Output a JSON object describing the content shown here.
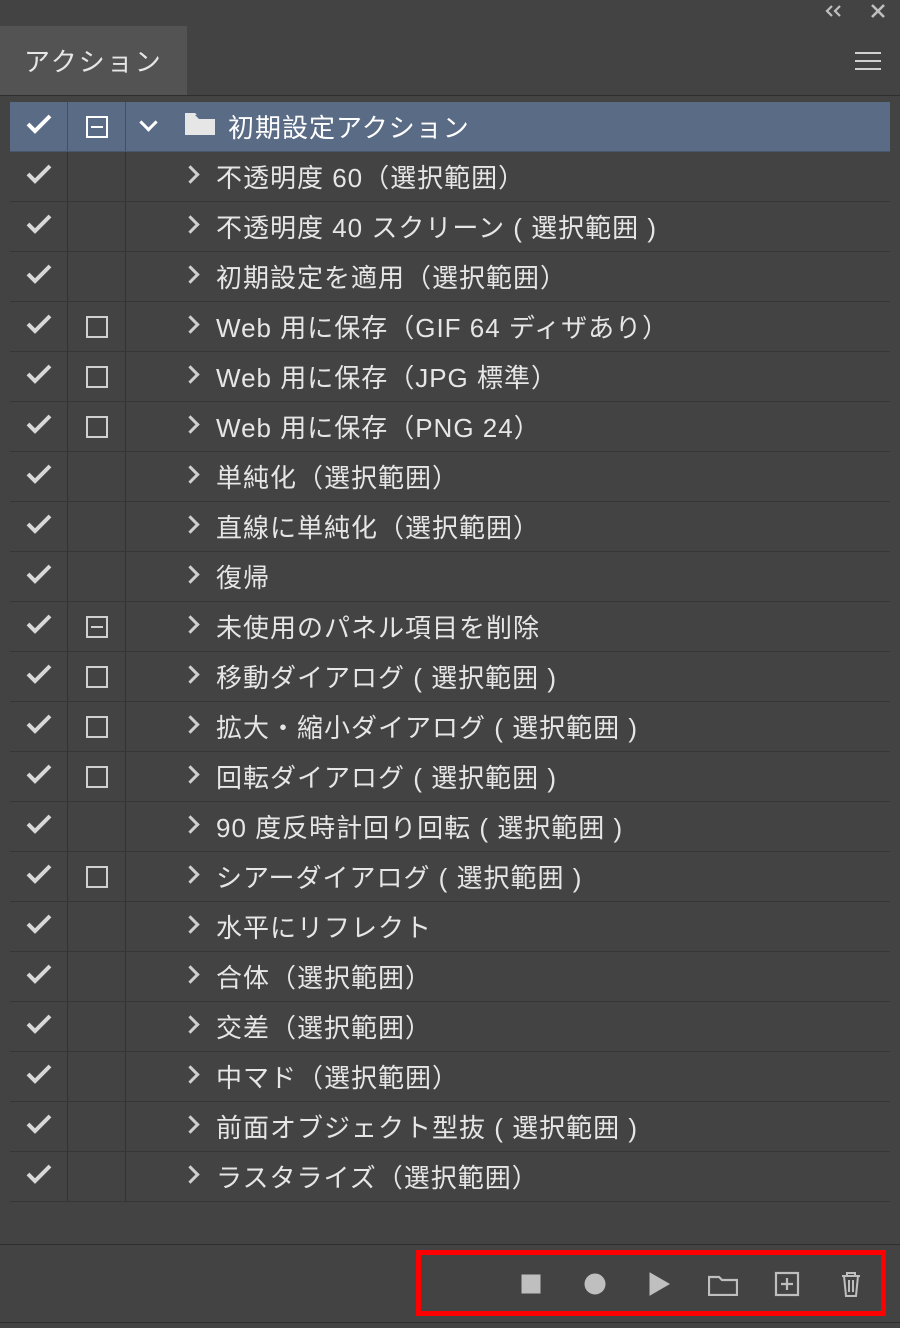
{
  "panel": {
    "tab_title": "アクション"
  },
  "set": {
    "name": "初期設定アクション"
  },
  "actions": [
    {
      "label": "不透明度 60（選択範囲）",
      "dialog": "none"
    },
    {
      "label": "不透明度 40 スクリーン ( 選択範囲 )",
      "dialog": "none"
    },
    {
      "label": "初期設定を適用（選択範囲）",
      "dialog": "none"
    },
    {
      "label": "Web 用に保存（GIF 64 ディザあり）",
      "dialog": "box"
    },
    {
      "label": "Web 用に保存（JPG 標準）",
      "dialog": "box"
    },
    {
      "label": "Web 用に保存（PNG 24）",
      "dialog": "box"
    },
    {
      "label": "単純化（選択範囲）",
      "dialog": "none"
    },
    {
      "label": "直線に単純化（選択範囲）",
      "dialog": "none"
    },
    {
      "label": "復帰",
      "dialog": "none"
    },
    {
      "label": "未使用のパネル項目を削除",
      "dialog": "minus"
    },
    {
      "label": "移動ダイアログ ( 選択範囲 )",
      "dialog": "box"
    },
    {
      "label": "拡大・縮小ダイアログ ( 選択範囲 )",
      "dialog": "box"
    },
    {
      "label": "回転ダイアログ ( 選択範囲 )",
      "dialog": "box"
    },
    {
      "label": "90 度反時計回り回転 ( 選択範囲 )",
      "dialog": "none"
    },
    {
      "label": "シアーダイアログ ( 選択範囲 )",
      "dialog": "box"
    },
    {
      "label": "水平にリフレクト",
      "dialog": "none"
    },
    {
      "label": "合体（選択範囲）",
      "dialog": "none"
    },
    {
      "label": "交差（選択範囲）",
      "dialog": "none"
    },
    {
      "label": "中マド（選択範囲）",
      "dialog": "none"
    },
    {
      "label": "前面オブジェクト型抜 ( 選択範囲 )",
      "dialog": "none"
    },
    {
      "label": "ラスタライズ（選択範囲）",
      "dialog": "none"
    }
  ]
}
